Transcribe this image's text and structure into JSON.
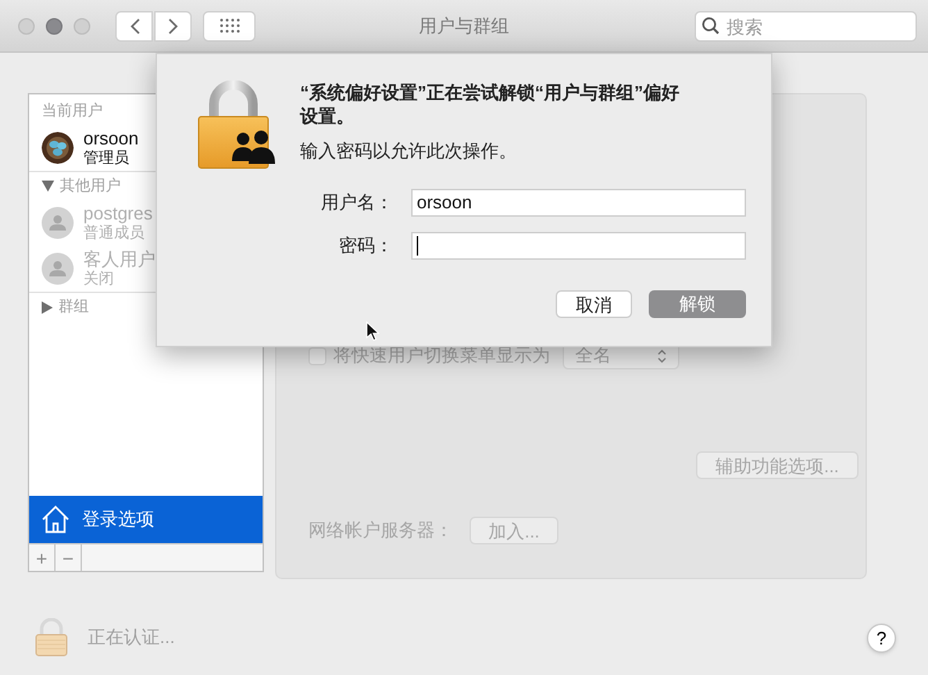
{
  "window": {
    "title": "用户与群组",
    "search": {
      "placeholder": "搜索"
    }
  },
  "sidebar": {
    "items": [
      {
        "kind": "section",
        "label": "当前用户"
      },
      {
        "kind": "user",
        "name": "orsoon",
        "role": "管理员",
        "photo": true,
        "disabled": false
      },
      {
        "kind": "section",
        "label": "其他用户",
        "expanded": true
      },
      {
        "kind": "user",
        "name": "postgres",
        "role": "普通成员",
        "photo": false,
        "disabled": true
      },
      {
        "kind": "user",
        "name": "客人用户",
        "role": "关闭",
        "photo": false,
        "disabled": true
      },
      {
        "kind": "section",
        "label": "群组",
        "expanded": false
      }
    ],
    "login_options": {
      "label": "登录选项",
      "selected": true
    },
    "list_buttons": [
      "+",
      "−"
    ]
  },
  "panel": {
    "disabled": true,
    "fast_switch": {
      "label": "将快速用户切换菜单显示为",
      "checked": false,
      "value": "全名"
    },
    "accessibility_button": "辅助功能选项...",
    "network_server": {
      "label": "网络帐户服务器：",
      "button": "加入..."
    }
  },
  "footer": {
    "status": "正在认证...",
    "help": "?"
  },
  "dialog": {
    "message": "“系统偏好设置”正在尝试解锁“用户与群组”偏好设置。",
    "prompt": "输入密码以允许此次操作。",
    "fields": [
      {
        "label": "用户名：",
        "value": "orsoon",
        "focused": false
      },
      {
        "label": "密码：",
        "focused": true
      }
    ],
    "buttons": [
      {
        "label": "取消",
        "default": false
      },
      {
        "label": "解锁",
        "default": true
      }
    ]
  }
}
